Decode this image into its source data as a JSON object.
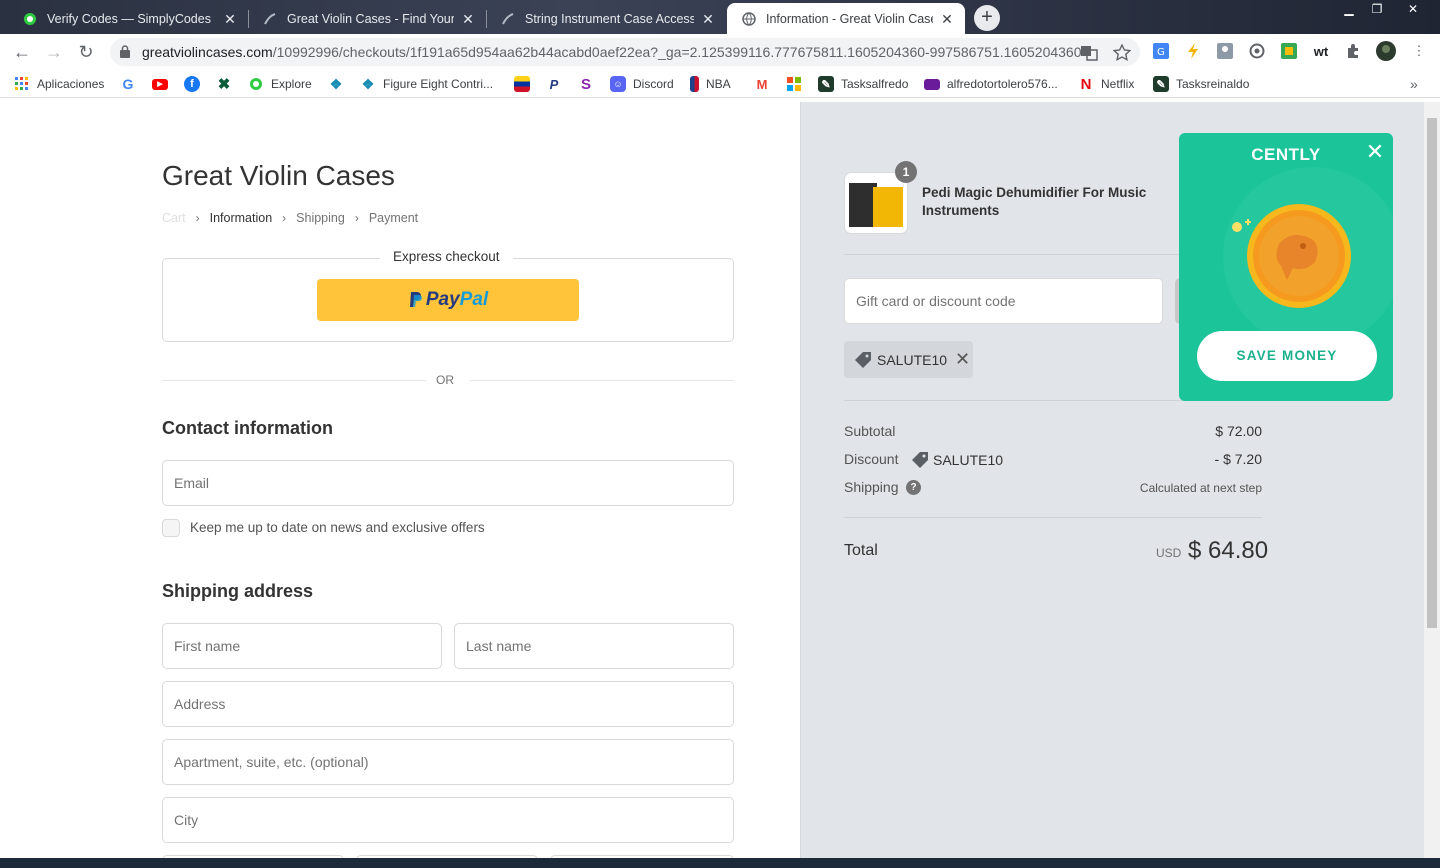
{
  "browser": {
    "tabs": [
      {
        "title": "Verify Codes — SimplyCodes",
        "active": false
      },
      {
        "title": "Great Violin Cases - Find Your Pe",
        "active": false
      },
      {
        "title": "String Instrument Case Accessori",
        "active": false
      },
      {
        "title": "Information - Great Violin Cases",
        "active": true
      }
    ],
    "url_host": "greatviolincases.com",
    "url_path": "/10992996/checkouts/1f191a65d954aa62b44acabd0aef22ea?_ga=2.125399116.777675811.1605204360-997586751.1605204360",
    "ext_wt": "wt",
    "bookmarks": {
      "apps": "Aplicaciones",
      "explore": "Explore",
      "figure_eight": "Figure Eight Contri...",
      "discord": "Discord",
      "nba": "NBA",
      "tasksalfredo": "Tasksalfredo",
      "alfredo_email": "alfredotortolero576...",
      "netflix": "Netflix",
      "tasksreinaldo": "Tasksreinaldo"
    }
  },
  "checkout": {
    "shop_name": "Great Violin Cases",
    "breadcrumb": {
      "cart": "Cart",
      "information": "Information",
      "shipping": "Shipping",
      "payment": "Payment"
    },
    "express_label": "Express checkout",
    "paypal_pay": "Pay",
    "paypal_pal": "Pal",
    "or_text": "OR",
    "contact_title": "Contact information",
    "email_placeholder": "Email",
    "newsletter_label": "Keep me up to date on news and exclusive offers",
    "shipping_title": "Shipping address",
    "first_name_placeholder": "First name",
    "last_name_placeholder": "Last name",
    "address_placeholder": "Address",
    "apartment_placeholder": "Apartment, suite, etc. (optional)",
    "city_placeholder": "City"
  },
  "summary": {
    "product_qty": "1",
    "product_name": "Pedi Magic Dehumidifier For Music Instruments",
    "gift_placeholder": "Gift card or discount code",
    "applied_code": "SALUTE10",
    "subtotal_label": "Subtotal",
    "subtotal_value": "$ 72.00",
    "discount_label": "Discount",
    "discount_code": "SALUTE10",
    "discount_value": "- $ 7.20",
    "shipping_label": "Shipping",
    "shipping_value": "Calculated at next step",
    "total_label": "Total",
    "currency": "USD",
    "total_value": "$ 64.80"
  },
  "cently": {
    "logo": "CENTLY",
    "button": "SAVE MONEY"
  },
  "colors": {
    "paypal_yellow": "#ffc439",
    "cently_green": "#1cc49a",
    "sidebar_bg": "#e1e4e8"
  }
}
